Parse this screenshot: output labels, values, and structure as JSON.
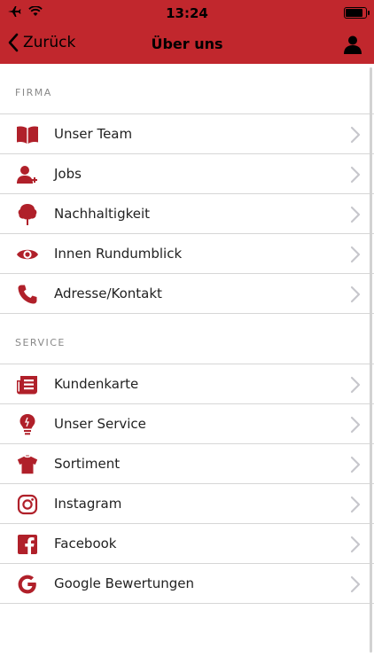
{
  "status": {
    "time": "13:24",
    "battery_level": 0.92
  },
  "nav": {
    "back_label": "Zurück",
    "title": "Über uns"
  },
  "sections": [
    {
      "header": "FIRMA",
      "items": [
        {
          "label": "Unser Team",
          "icon": "book-icon"
        },
        {
          "label": "Jobs",
          "icon": "add-user-icon"
        },
        {
          "label": "Nachhaltigkeit",
          "icon": "tree-icon"
        },
        {
          "label": "Innen Rundumblick",
          "icon": "eye-icon"
        },
        {
          "label": "Adresse/Kontakt",
          "icon": "phone-icon"
        }
      ]
    },
    {
      "header": "SERVICE",
      "items": [
        {
          "label": "Kundenkarte",
          "icon": "newspaper-icon"
        },
        {
          "label": "Unser Service",
          "icon": "lightbulb-icon"
        },
        {
          "label": "Sortiment",
          "icon": "shirt-icon"
        },
        {
          "label": "Instagram",
          "icon": "instagram-icon"
        },
        {
          "label": "Facebook",
          "icon": "facebook-icon"
        },
        {
          "label": "Google Bewertungen",
          "icon": "google-icon"
        }
      ]
    }
  ],
  "colors": {
    "accent": "#c1272d",
    "icon": "#b0202a",
    "divider": "#d6d6d6",
    "chevron": "#c7c7cc"
  }
}
